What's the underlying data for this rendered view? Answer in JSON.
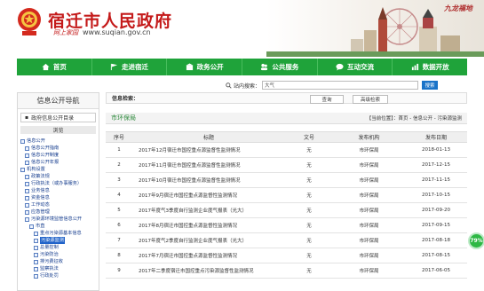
{
  "header": {
    "title": "宿迁市人民政府",
    "sub": "网上家园",
    "url": "www.suqian.gov.cn",
    "logo_text": "九龙福地"
  },
  "nav": [
    {
      "label": "首页",
      "icon": "home-icon"
    },
    {
      "label": "走进宿迁",
      "icon": "flag-icon"
    },
    {
      "label": "政务公开",
      "icon": "building-icon"
    },
    {
      "label": "公共服务",
      "icon": "people-icon"
    },
    {
      "label": "互动交流",
      "icon": "chat-icon"
    },
    {
      "label": "数据开放",
      "icon": "chart-icon"
    }
  ],
  "search": {
    "label": "站内搜索：",
    "value": "大气",
    "button": "搜索"
  },
  "sidebar": {
    "title": "信息公开导航",
    "catalog": "政府信息公开目录",
    "browse": "浏览",
    "tree": [
      {
        "label": "信息公开",
        "level": 0
      },
      {
        "label": "信息公开指南",
        "level": 1
      },
      {
        "label": "信息公开制度",
        "level": 1
      },
      {
        "label": "信息公开年报",
        "level": 1
      },
      {
        "label": "机构设置",
        "level": 0
      },
      {
        "label": "政策法规",
        "level": 1
      },
      {
        "label": "行政执法（或办事服务）",
        "level": 1
      },
      {
        "label": "业务信息",
        "level": 1
      },
      {
        "label": "资金信息",
        "level": 1
      },
      {
        "label": "工作动态",
        "level": 1
      },
      {
        "label": "应急管理",
        "level": 1
      },
      {
        "label": "污染源环境监管信息公开",
        "level": 1
      },
      {
        "label": "市直",
        "level": 2
      },
      {
        "label": "重点污染源基本信息",
        "level": 3
      },
      {
        "label": "污染源监测",
        "level": 3,
        "selected": true
      },
      {
        "label": "总量控制",
        "level": 3
      },
      {
        "label": "污染防治",
        "level": 3
      },
      {
        "label": "排污费征收",
        "level": 3
      },
      {
        "label": "监察执法",
        "level": 3
      },
      {
        "label": "行政处罚",
        "level": 3
      }
    ]
  },
  "filter": {
    "label": "信息检索：",
    "query_btn": "查询",
    "advanced_btn": "高级检索"
  },
  "crumb": {
    "title": "市环保局",
    "path": "【当前位置】：首页 - 信息公开 - 污染源监测"
  },
  "table": {
    "headers": [
      "序号",
      "标题",
      "文号",
      "发布机构",
      "发布日期"
    ],
    "rows": [
      [
        "1",
        "2017年12月宿迁市国控重点源监督性监测情况",
        "无",
        "市环保局",
        "2018-01-13"
      ],
      [
        "2",
        "2017年11月宿迁市国控重点源监督性监测情况",
        "无",
        "市环保局",
        "2017-12-15"
      ],
      [
        "3",
        "2017年10月宿迁市国控重点源监督性监测情况",
        "无",
        "市环保局",
        "2017-11-15"
      ],
      [
        "4",
        "2017年9月宿迁市国控重点源监督性监测情况",
        "无",
        "市环保局",
        "2017-10-15"
      ],
      [
        "5",
        "2017年度气3季度自行监测企业度气报表（光大）",
        "无",
        "市环保局",
        "2017-09-20"
      ],
      [
        "6",
        "2017年8月宿迁市国控重点源监督性监测情况",
        "无",
        "市环保局",
        "2017-09-15"
      ],
      [
        "7",
        "2017年度气2季度自行监测企业度气报表（光大）",
        "无",
        "市环保局",
        "2017-08-18"
      ],
      [
        "8",
        "2017年7月宿迁市国控重点源监督性监测情况",
        "无",
        "市环保局",
        "2017-08-15"
      ],
      [
        "9",
        "2017年二季度宿迁市国控重点污染源监督性监测情况",
        "无",
        "市环保局",
        "2017-06-05"
      ]
    ]
  },
  "badge": "79%",
  "colors": {
    "nav": "#1fa33a",
    "title_red": "#c41a1a",
    "link": "#123a8c"
  }
}
